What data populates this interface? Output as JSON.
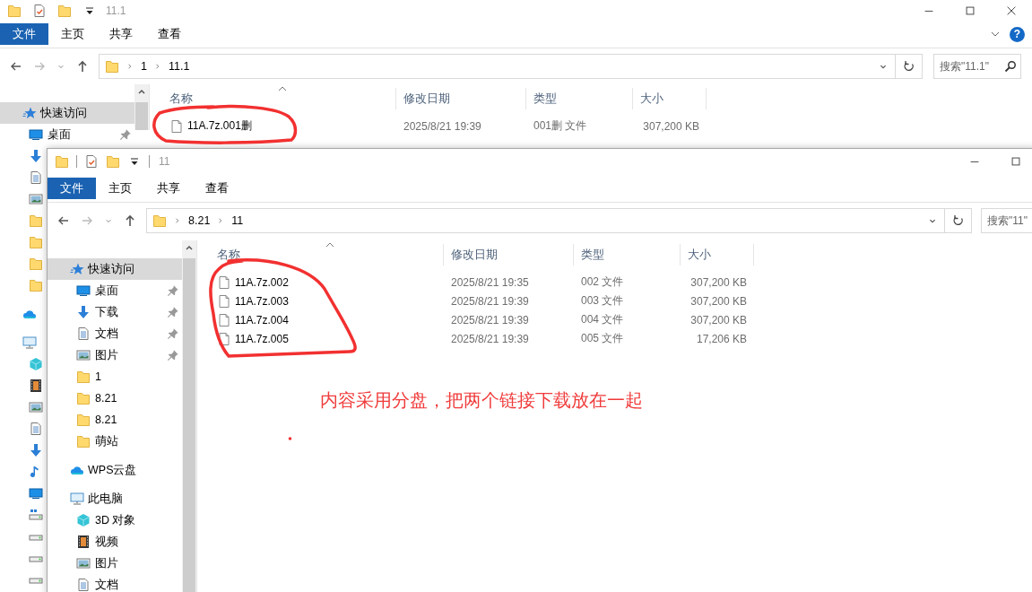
{
  "windows": [
    {
      "title": "11.1",
      "help": "?",
      "ribbon_tabs": [
        {
          "label": "文件",
          "selected": true
        },
        {
          "label": "主页",
          "selected": false
        },
        {
          "label": "共享",
          "selected": false
        },
        {
          "label": "查看",
          "selected": false
        }
      ],
      "address": [
        "1",
        "11.1"
      ],
      "search": {
        "placeholder": "搜索\"11.1\""
      },
      "nav_items": [
        {
          "kind": "quick-access",
          "label": "快速访问",
          "selected": true,
          "pinned": false
        },
        {
          "kind": "desktop",
          "label": "桌面",
          "selected": false,
          "pinned": true
        },
        {
          "kind": "download",
          "selected": false,
          "pinned": false
        },
        {
          "kind": "document",
          "selected": false,
          "pinned": false
        },
        {
          "kind": "picture",
          "selected": false,
          "pinned": false
        },
        {
          "kind": "folder",
          "selected": false,
          "pinned": false
        },
        {
          "kind": "folder",
          "selected": false,
          "pinned": false
        },
        {
          "kind": "folder",
          "selected": false,
          "pinned": false
        },
        {
          "kind": "folder",
          "selected": false,
          "pinned": false
        },
        {
          "kind": "cloud",
          "selected": false,
          "pinned": false
        },
        {
          "kind": "pc",
          "selected": false,
          "pinned": false
        },
        {
          "kind": "cube",
          "selected": false,
          "pinned": false
        },
        {
          "kind": "film",
          "selected": false,
          "pinned": false
        },
        {
          "kind": "picture",
          "selected": false,
          "pinned": false
        },
        {
          "kind": "document",
          "selected": false,
          "pinned": false
        },
        {
          "kind": "download",
          "selected": false,
          "pinned": false
        },
        {
          "kind": "music",
          "selected": false,
          "pinned": false
        },
        {
          "kind": "desktop",
          "selected": false,
          "pinned": false
        },
        {
          "kind": "system-drive",
          "selected": false,
          "pinned": false
        },
        {
          "kind": "drive",
          "selected": false,
          "pinned": false
        },
        {
          "kind": "drive",
          "selected": false,
          "pinned": false
        },
        {
          "kind": "drive",
          "selected": false,
          "pinned": false
        }
      ],
      "columns": [
        "名称",
        "修改日期",
        "类型",
        "大小"
      ],
      "files": [
        {
          "name": "11A.7z.001删",
          "modified": "2025/8/21 19:39",
          "type": "001删 文件",
          "size": "307,200 KB"
        }
      ]
    },
    {
      "title": "11",
      "ribbon_tabs": [
        {
          "label": "文件",
          "selected": true
        },
        {
          "label": "主页",
          "selected": false
        },
        {
          "label": "共享",
          "selected": false
        },
        {
          "label": "查看",
          "selected": false
        }
      ],
      "address": [
        "8.21",
        "11"
      ],
      "search": {
        "placeholder": "搜索\"11\""
      },
      "nav_items": [
        {
          "kind": "quick-access",
          "label": "快速访问",
          "selected": true,
          "pinned": false
        },
        {
          "kind": "desktop",
          "label": "桌面",
          "selected": false,
          "pinned": true
        },
        {
          "kind": "download",
          "label": "下载",
          "selected": false,
          "pinned": true
        },
        {
          "kind": "document",
          "label": "文档",
          "selected": false,
          "pinned": true
        },
        {
          "kind": "picture",
          "label": "图片",
          "selected": false,
          "pinned": true
        },
        {
          "kind": "folder",
          "label": "1",
          "selected": false,
          "pinned": false
        },
        {
          "kind": "folder",
          "label": "8.21",
          "selected": false,
          "pinned": false
        },
        {
          "kind": "folder",
          "label": "8.21",
          "selected": false,
          "pinned": false
        },
        {
          "kind": "folder",
          "label": "萌站",
          "selected": false,
          "pinned": false
        },
        {
          "kind": "cloud",
          "label": "WPS云盘",
          "selected": false,
          "pinned": false
        },
        {
          "kind": "pc",
          "label": "此电脑",
          "selected": false,
          "pinned": false
        },
        {
          "kind": "cube",
          "label": "3D 对象",
          "selected": false,
          "pinned": false
        },
        {
          "kind": "film",
          "label": "视频",
          "selected": false,
          "pinned": false
        },
        {
          "kind": "picture",
          "label": "图片",
          "selected": false,
          "pinned": false
        },
        {
          "kind": "document",
          "label": "文档",
          "selected": false,
          "pinned": false
        }
      ],
      "columns": [
        "名称",
        "修改日期",
        "类型",
        "大小"
      ],
      "files": [
        {
          "name": "11A.7z.002",
          "modified": "2025/8/21 19:35",
          "type": "002 文件",
          "size": "307,200 KB"
        },
        {
          "name": "11A.7z.003",
          "modified": "2025/8/21 19:39",
          "type": "003 文件",
          "size": "307,200 KB"
        },
        {
          "name": "11A.7z.004",
          "modified": "2025/8/21 19:39",
          "type": "004 文件",
          "size": "307,200 KB"
        },
        {
          "name": "11A.7z.005",
          "modified": "2025/8/21 19:39",
          "type": "005 文件",
          "size": "17,206 KB"
        }
      ]
    }
  ],
  "annotation": {
    "note": "内容采用分盘，把两个链接下载放在一起"
  }
}
